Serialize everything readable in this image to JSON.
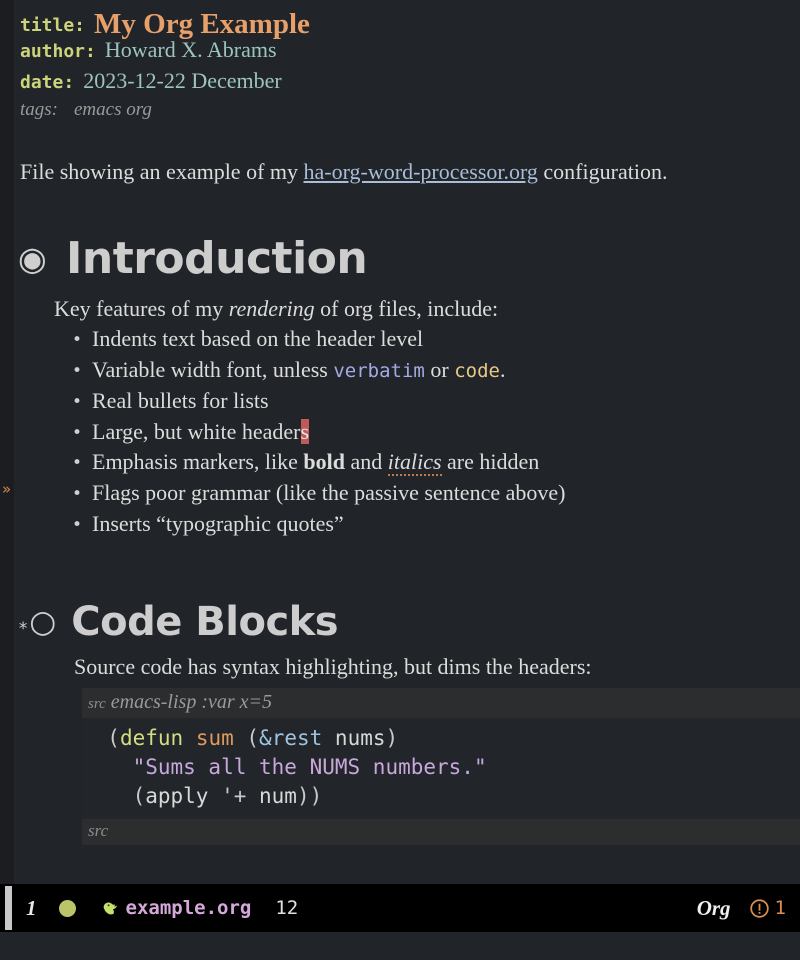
{
  "buffer": {
    "keywords": [
      {
        "key": "title:",
        "value": "My Org Example"
      },
      {
        "key": "author:",
        "value": "Howard X. Abrams"
      },
      {
        "key": "date:",
        "value": "2023-12-22 December"
      },
      {
        "key": "tags:",
        "value": "emacs org"
      }
    ],
    "intro": {
      "before_link": "File showing an example of my ",
      "link_text": "ha-org-word-processor.org",
      "after_link": " configuration."
    },
    "sections": [
      {
        "bullet": "circled-dot-bullet",
        "bullet_glyph": "◉",
        "heading": "Introduction",
        "lead": {
          "before_em": "Key features of my ",
          "em": "rendering",
          "after_em": " of org files, include:"
        },
        "bullets": [
          {
            "parts": [
              {
                "t": "Indents text based on the header level",
                "f": "plain"
              }
            ]
          },
          {
            "parts": [
              {
                "t": "Variable width font, unless ",
                "f": "plain"
              },
              {
                "t": "verbatim",
                "f": "verbatim"
              },
              {
                "t": " or ",
                "f": "plain"
              },
              {
                "t": "code",
                "f": "code"
              },
              {
                "t": ".",
                "f": "plain"
              }
            ]
          },
          {
            "parts": [
              {
                "t": "Real bullets for lists",
                "f": "plain"
              }
            ]
          },
          {
            "parts": [
              {
                "t": "Large, but white header",
                "f": "plain"
              },
              {
                "t": "s",
                "f": "cursor"
              }
            ]
          },
          {
            "parts": [
              {
                "t": "Emphasis markers, like ",
                "f": "plain"
              },
              {
                "t": "bold",
                "f": "bold"
              },
              {
                "t": " and ",
                "f": "plain"
              },
              {
                "t": "italics",
                "f": "italic-flag"
              },
              {
                "t": " are hidden",
                "f": "plain"
              }
            ]
          },
          {
            "parts": [
              {
                "t": "Flags poor grammar (like the passive sentence above)",
                "f": "plain"
              }
            ]
          },
          {
            "parts": [
              {
                "t": "Inserts “typographic quotes”",
                "f": "plain"
              }
            ]
          }
        ]
      },
      {
        "bullet": "open-circle-bullet",
        "stars": "*",
        "bullet_glyph": "○",
        "heading": "Code Blocks",
        "lead_plain": "Source code has syntax highlighting, but dims the headers:",
        "src_block": {
          "begin_keyword": "src",
          "begin_args": "emacs-lisp :var x=5",
          "end_keyword": "src",
          "language": "emacs-lisp",
          "code_lines": [
            [
              {
                "t": "  (",
                "c": "pun"
              },
              {
                "t": "defun",
                "c": "def"
              },
              {
                "t": " ",
                "c": "pun"
              },
              {
                "t": "sum",
                "c": "fn"
              },
              {
                "t": " (",
                "c": "pun"
              },
              {
                "t": "&rest",
                "c": "kw"
              },
              {
                "t": " ",
                "c": "pun"
              },
              {
                "t": "nums",
                "c": "var"
              },
              {
                "t": ")",
                "c": "pun"
              }
            ],
            [
              {
                "t": "    ",
                "c": "pun"
              },
              {
                "t": "\"Sums all the NUMS numbers.\"",
                "c": "str"
              }
            ],
            [
              {
                "t": "    (",
                "c": "pun"
              },
              {
                "t": "apply",
                "c": "var"
              },
              {
                "t": " '+ ",
                "c": "pun"
              },
              {
                "t": "num",
                "c": "var"
              },
              {
                "t": "))",
                "c": "pun"
              }
            ]
          ]
        }
      }
    ],
    "fringe_marker": "»"
  },
  "modeline": {
    "window_number": "1",
    "status_dot": "olive-status-dot",
    "gnu_icon": "gnu-emacs-icon",
    "buffer_name": "example.org",
    "column": "12",
    "major_mode": "Org",
    "warning_icon": "warning-circle-icon",
    "warning_count": "1"
  },
  "colors": {
    "background": "#212428",
    "fringe": "#1b1d21",
    "keyword": "#ccd37a",
    "title_value": "#e8a06a",
    "meta_value": "#9cc4c0",
    "tags": "#9a9a9a",
    "link": "#a8bdd8",
    "heading": "#cdcdcd",
    "verbatim": "#a3aae4",
    "code": "#e8c88a",
    "cursor": "#c05a5a",
    "modeline_bg": "#000000",
    "buffer_name": "#d4a8d8",
    "warning": "#d98f4e",
    "src_header_bg": "#2b2d2f",
    "src_body_bg": "#222529"
  }
}
